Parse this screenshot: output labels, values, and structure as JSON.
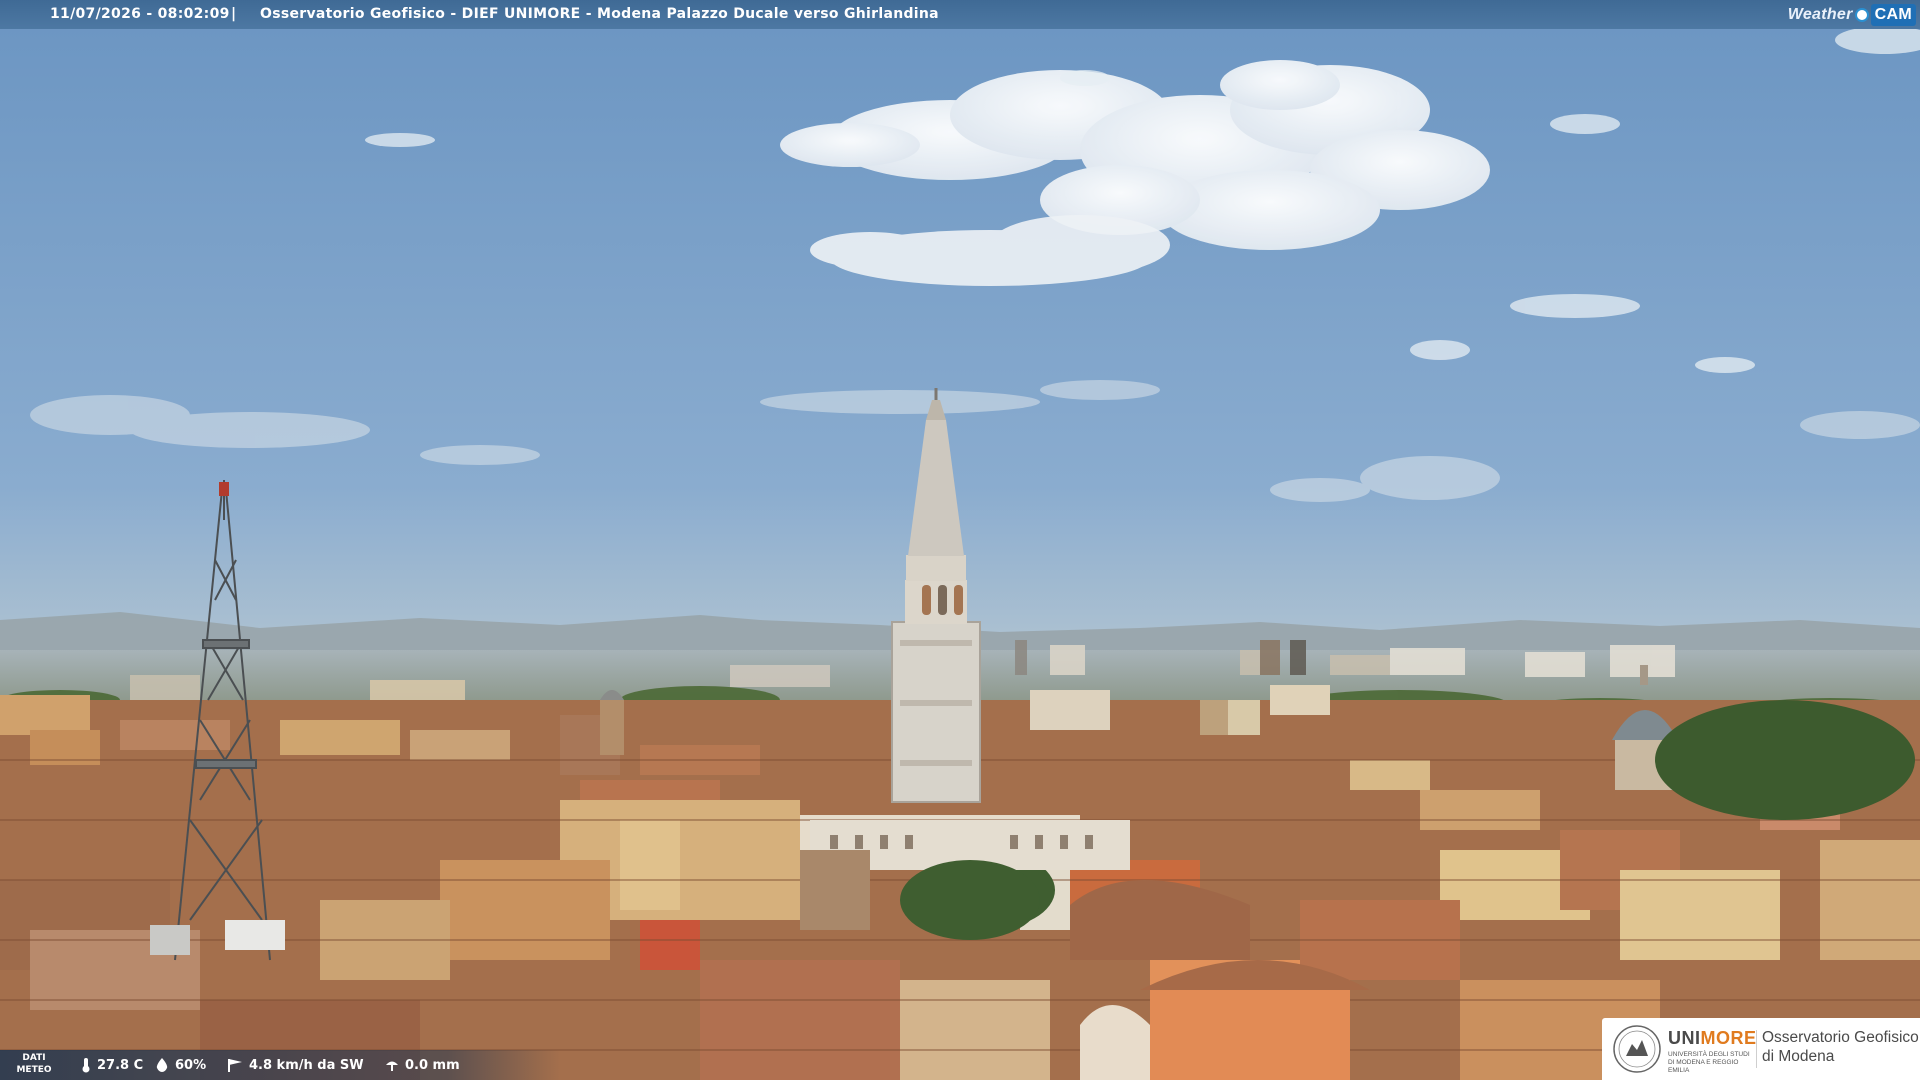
{
  "header": {
    "timestamp": "11/07/2026 - 08:02:09",
    "separator": "|",
    "title": "Osservatorio Geofisico - DIEF UNIMORE - Modena Palazzo Ducale verso Ghirlandina"
  },
  "brand": {
    "weather": "Weather",
    "cam": "CAM"
  },
  "weather": {
    "label_line1": "DATI",
    "label_line2": "METEO",
    "temperature": "27.8 C",
    "humidity": "60%",
    "wind": "4.8 km/h da SW",
    "rain": "0.0 mm",
    "icons": [
      "thermometer-icon",
      "humidity-drop-icon",
      "wind-vane-icon",
      "rain-icon"
    ]
  },
  "logo": {
    "uni_a": "UNI",
    "uni_b": "MORE",
    "uni_sub": "UNIVERSITÀ DEGLI STUDI DI MODENA E REGGIO EMILIA",
    "obs_line1": "Osservatorio Geofisico",
    "obs_line2": "di Modena"
  },
  "colors": {
    "sky_top": "#6f98c4",
    "sky_horizon": "#b8c7d1",
    "roof": "#a5704e",
    "tower": "#d9d5cc",
    "accent_orange": "#e07b1f"
  }
}
